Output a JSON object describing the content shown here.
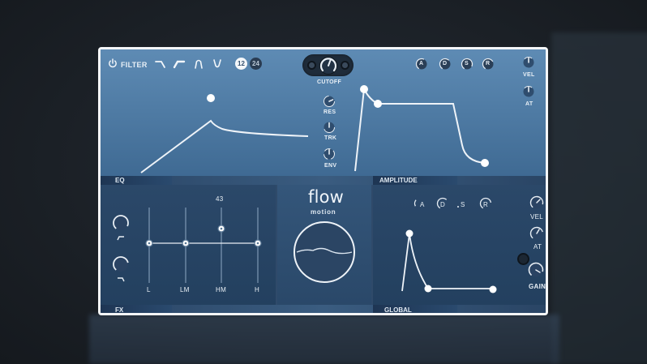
{
  "filter": {
    "power_icon": "power-icon",
    "title": "FILTER",
    "shapes": [
      "lowpass-icon",
      "highpass-icon",
      "bandpass-icon",
      "notch-icon"
    ],
    "slope_options": [
      "12",
      "24"
    ],
    "slope_selected": "12",
    "cutoff_label": "CUTOFF",
    "res_label": "RES",
    "trk_label": "TRK",
    "env_label": "ENV"
  },
  "amp_env": {
    "adsr_labels": [
      "A",
      "D",
      "S",
      "R"
    ],
    "vel_label": "VEL",
    "at_label": "AT"
  },
  "tabs": {
    "eq": "EQ",
    "amplitude": "AMPLITUDE",
    "fx": "FX",
    "global": "GLOBAL"
  },
  "eq": {
    "value_readout": "43",
    "bands": [
      "L",
      "LM",
      "HM",
      "H"
    ]
  },
  "logo": {
    "line1": "flow",
    "line2": "motion"
  },
  "global": {
    "adsr_labels": [
      "A",
      "D",
      "S",
      "R"
    ],
    "vel_label": "VEL",
    "at_label": "AT",
    "gain_label": "GAIN"
  },
  "colors": {
    "panel_top": "#5e8bb4",
    "panel_dark": "#23405f",
    "accent_white": "#ffffff"
  }
}
